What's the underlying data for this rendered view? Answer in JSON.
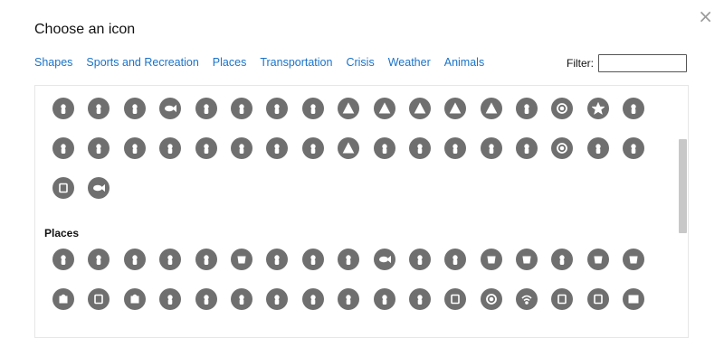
{
  "dialog": {
    "title": "Choose an icon",
    "close_glyph": "×"
  },
  "tabs": [
    "Shapes",
    "Sports and Recreation",
    "Places",
    "Transportation",
    "Crisis",
    "Weather",
    "Animals"
  ],
  "filter": {
    "label": "Filter:",
    "value": ""
  },
  "sections": [
    {
      "label": "",
      "rows": [
        [
          "swimming-icon",
          "snorkel-icon",
          "kayak-icon",
          "fish-icon",
          "ski-jump-icon",
          "parachute-icon",
          "golf-icon",
          "picnic-table-icon",
          "tree-icon",
          "round-tree-icon",
          "palm-tree-icon",
          "mountain-icon",
          "campsite-icon",
          "hot-spring-icon",
          "waterfall-icon",
          "star-icon",
          "hiker-icon"
        ],
        [
          "hiking-icon",
          "hikers-icon",
          "flag-icon",
          "deer-icon",
          "hunting-icon",
          "archery-icon",
          "telescope-icon",
          "binoculars-icon",
          "tent-icon",
          "guitar-icon",
          "campfire-icon",
          "grill-icon",
          "axe-icon",
          "caravan-icon",
          "atv-icon",
          "rv-icon",
          "trailer-icon"
        ],
        [
          "billboard-icon",
          "fishing-icon"
        ]
      ]
    },
    {
      "label": "Places",
      "rows": [
        [
          "restaurant-icon",
          "fast-food-icon",
          "burger-icon",
          "bread-icon",
          "pizza-icon",
          "bowl-icon",
          "dumpling-icon",
          "cow-icon",
          "chicken-icon",
          "fish-food-icon",
          "ice-cream-icon",
          "cocktail-icon",
          "cup-icon",
          "beer-mug-icon",
          "wine-icon",
          "coffee-icon",
          "tea-icon"
        ],
        [
          "shopping-bag-icon",
          "cash-register-icon",
          "cart-icon",
          "bottles-icon",
          "shoe-icon",
          "hanger-icon",
          "ring-icon",
          "flower-icon",
          "grain-icon",
          "sign-icon",
          "pharmacy-icon",
          "phone-icon",
          "email-at-icon",
          "wifi-icon",
          "laptop-icon",
          "monitor-icon",
          "book-icon"
        ]
      ]
    }
  ]
}
